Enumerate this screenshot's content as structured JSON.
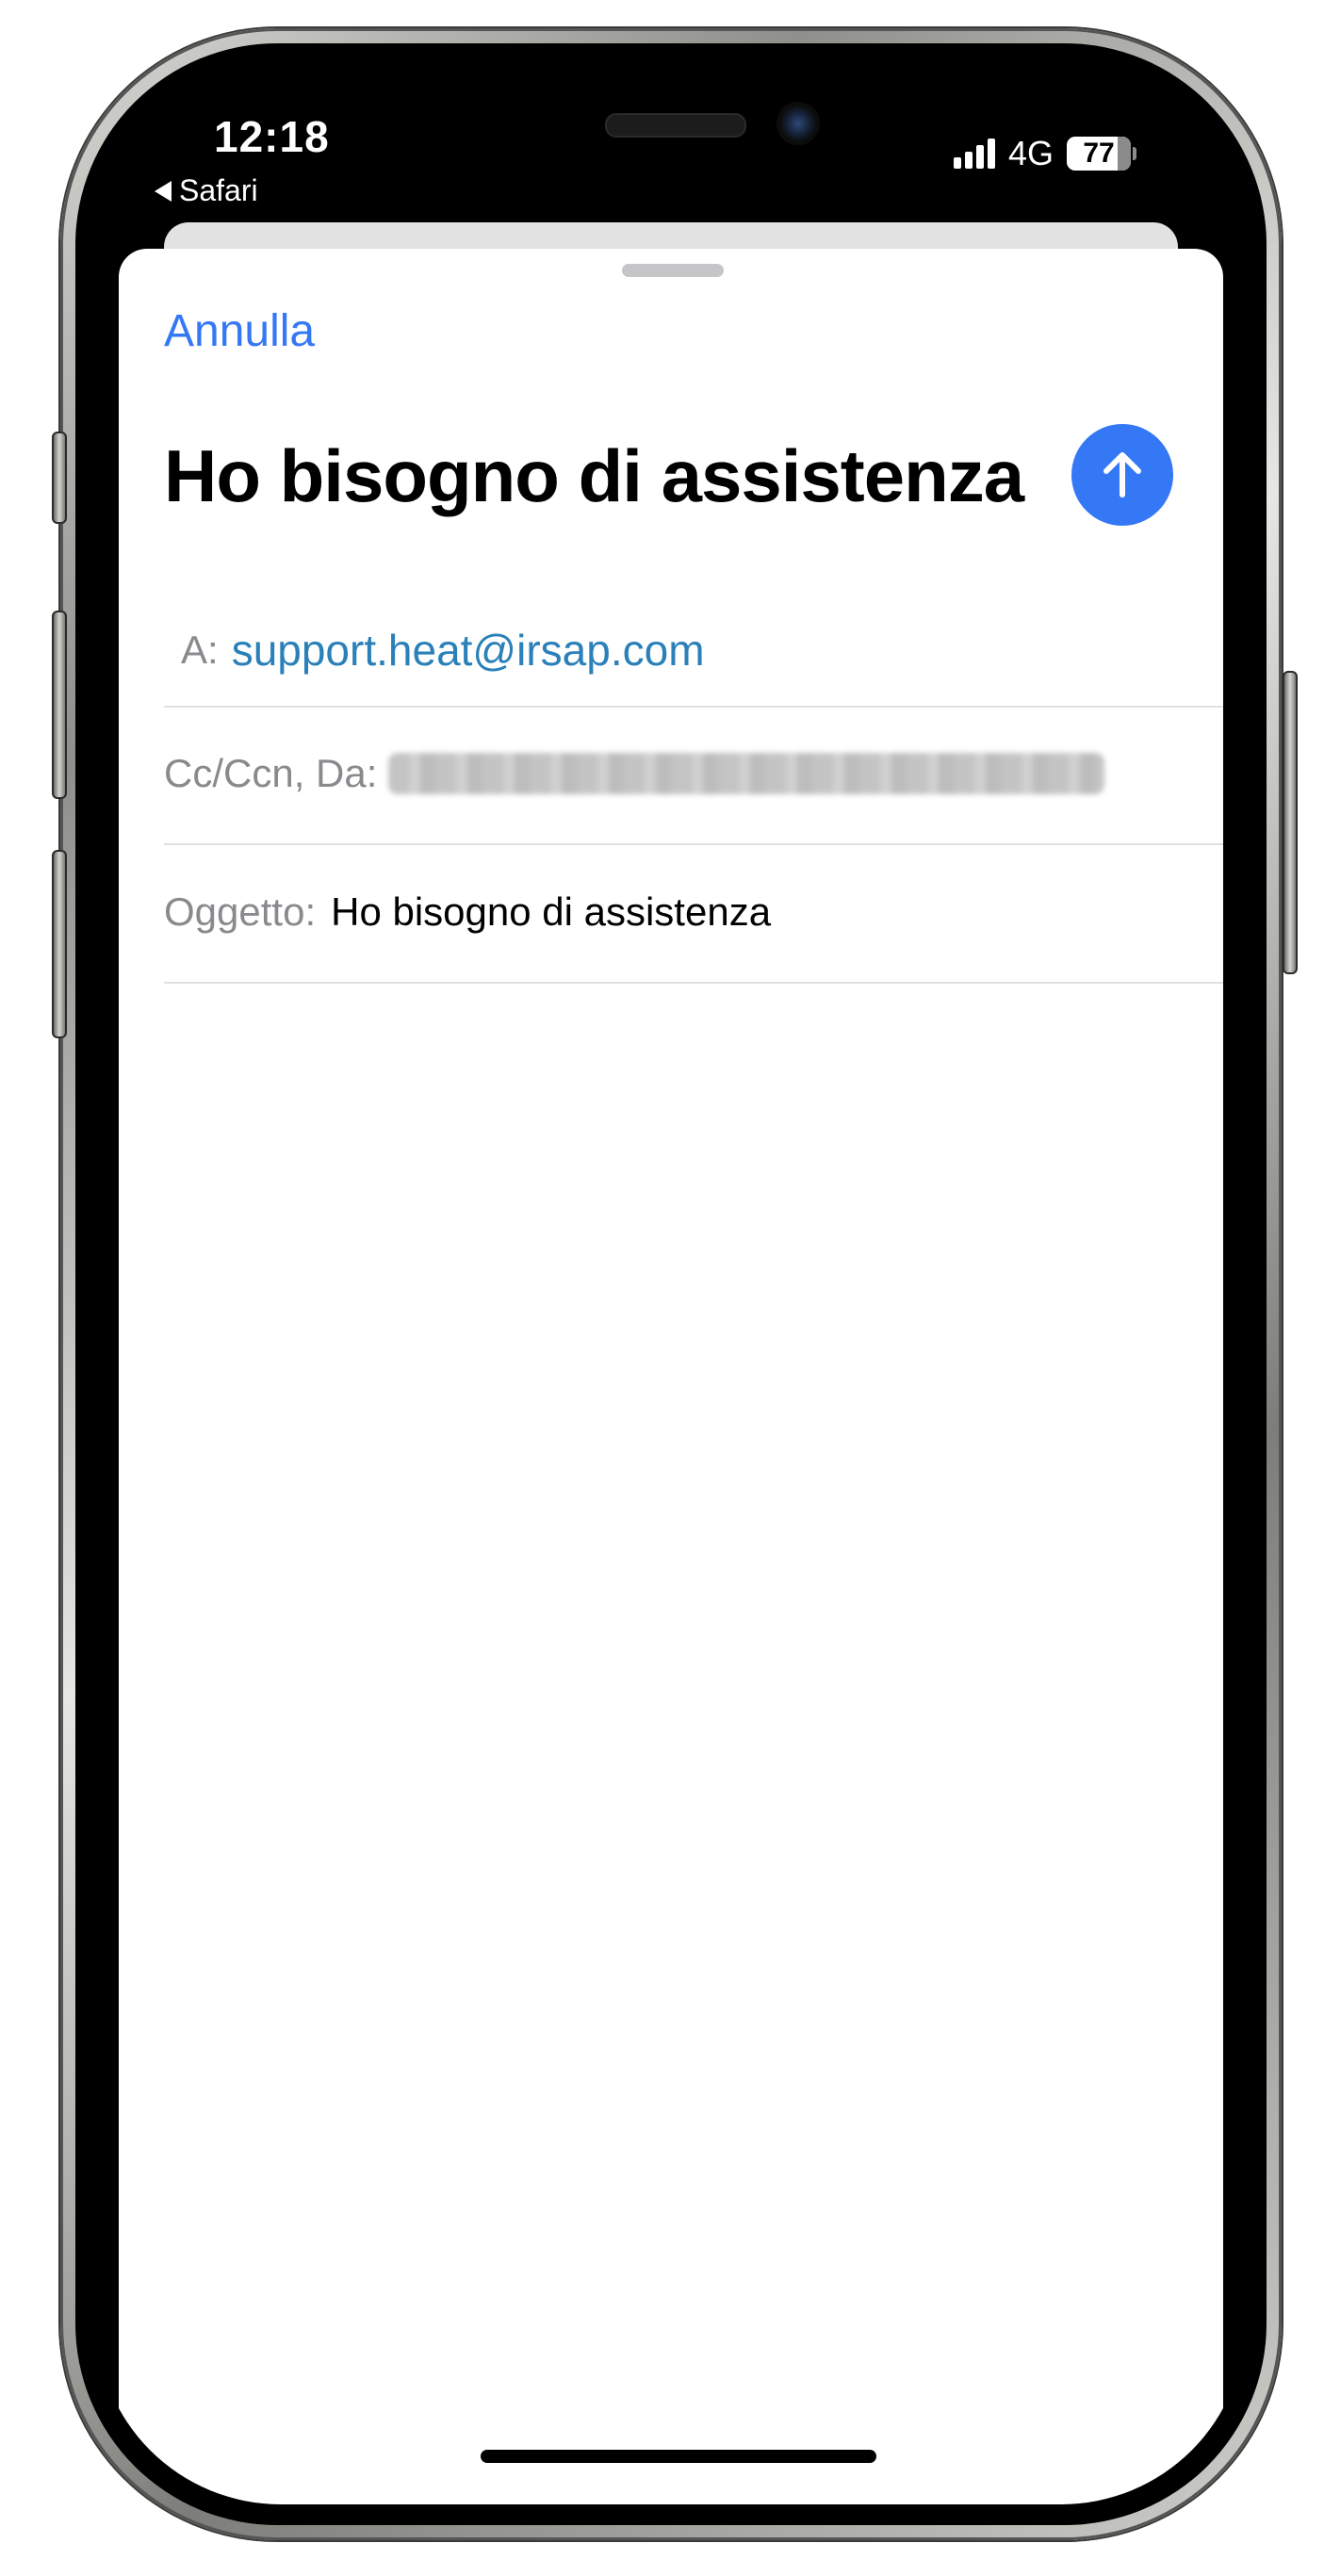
{
  "status_bar": {
    "time": "12:18",
    "back_label": "Safari",
    "network": "4G",
    "battery": "77"
  },
  "compose": {
    "cancel_label": "Annulla",
    "title": "Ho bisogno di assistenza",
    "to_label": "A:",
    "to_value": "support.heat@irsap.com",
    "cc_label": "Cc/Ccn, Da:",
    "subject_label": "Oggetto:",
    "subject_value": "Ho bisogno di assistenza"
  },
  "colors": {
    "accent": "#3478f6",
    "recipient": "#2a80b9"
  },
  "icons": {
    "send": "arrow-up-icon",
    "back": "back-triangle-icon"
  }
}
